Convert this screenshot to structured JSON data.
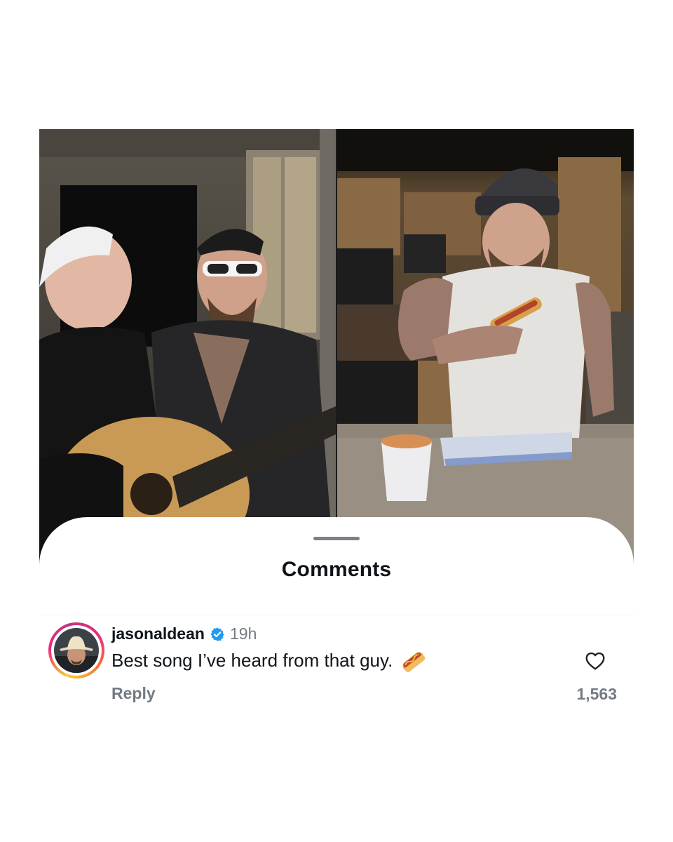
{
  "colors": {
    "background": "#ffffff",
    "text_primary": "#0f1419",
    "text_secondary": "#737b84",
    "verified": "#1d9bf0",
    "avatar_ring": [
      "#f9ce34",
      "#ee2a7b",
      "#c13584"
    ]
  },
  "video": {
    "left_clip": "two men singing, one playing an acoustic guitar on a porch at night",
    "right_clip": "man in a cap and sleeveless shirt holding a hot dog in a kitchen"
  },
  "comments_sheet": {
    "title": "Comments",
    "comments": [
      {
        "username": "jasonaldean",
        "verified": true,
        "timestamp": "19h",
        "text": "Best song I’ve heard from that guy.",
        "emoji": "hotdog",
        "reply_label": "Reply",
        "like_count": "1,563"
      }
    ]
  },
  "icons": [
    "verified-badge-icon",
    "hotdog-emoji-icon",
    "heart-icon"
  ]
}
